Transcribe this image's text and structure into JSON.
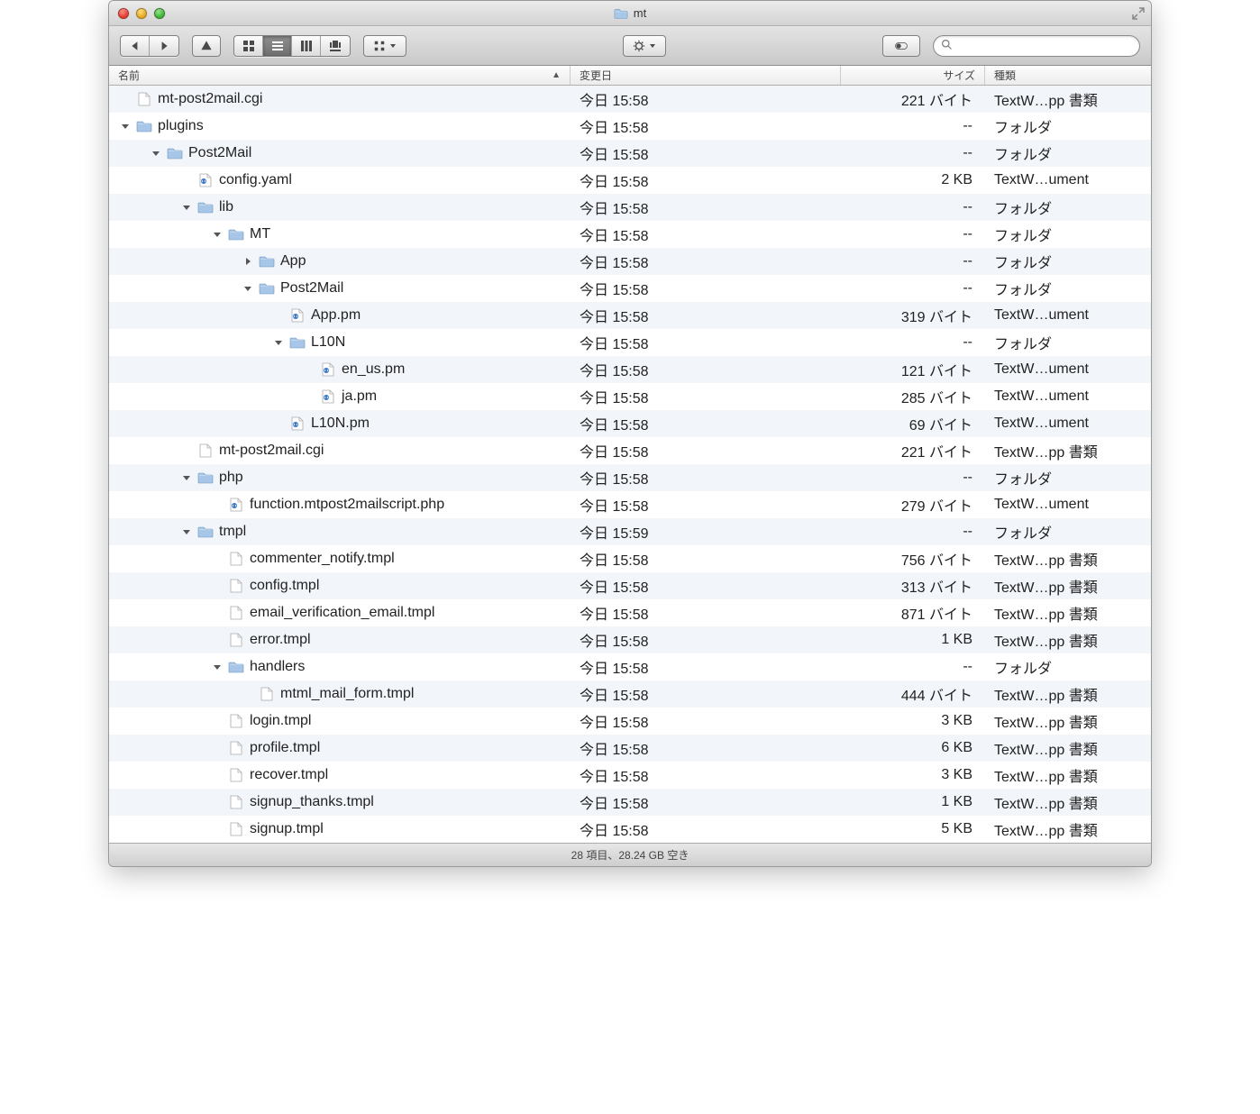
{
  "window": {
    "title": "mt"
  },
  "columns": {
    "name": "名前",
    "date": "変更日",
    "size": "サイズ",
    "kind": "種類"
  },
  "rows": [
    {
      "indent": 0,
      "disclosure": "none",
      "icon": "doc",
      "name": "mt-post2mail.cgi",
      "date": "今日 15:58",
      "size": "221 バイト",
      "kind": "TextW…pp 書類"
    },
    {
      "indent": 0,
      "disclosure": "open",
      "icon": "folder",
      "name": "plugins",
      "date": "今日 15:58",
      "size": "--",
      "kind": "フォルダ"
    },
    {
      "indent": 1,
      "disclosure": "open",
      "icon": "folder",
      "name": "Post2Mail",
      "date": "今日 15:58",
      "size": "--",
      "kind": "フォルダ"
    },
    {
      "indent": 2,
      "disclosure": "none",
      "icon": "code",
      "name": "config.yaml",
      "date": "今日 15:58",
      "size": "2 KB",
      "kind": "TextW…ument"
    },
    {
      "indent": 2,
      "disclosure": "open",
      "icon": "folder",
      "name": "lib",
      "date": "今日 15:58",
      "size": "--",
      "kind": "フォルダ"
    },
    {
      "indent": 3,
      "disclosure": "open",
      "icon": "folder",
      "name": "MT",
      "date": "今日 15:58",
      "size": "--",
      "kind": "フォルダ"
    },
    {
      "indent": 4,
      "disclosure": "closed",
      "icon": "folder",
      "name": "App",
      "date": "今日 15:58",
      "size": "--",
      "kind": "フォルダ"
    },
    {
      "indent": 4,
      "disclosure": "open",
      "icon": "folder",
      "name": "Post2Mail",
      "date": "今日 15:58",
      "size": "--",
      "kind": "フォルダ"
    },
    {
      "indent": 5,
      "disclosure": "none",
      "icon": "code",
      "name": "App.pm",
      "date": "今日 15:58",
      "size": "319 バイト",
      "kind": "TextW…ument"
    },
    {
      "indent": 5,
      "disclosure": "open",
      "icon": "folder",
      "name": "L10N",
      "date": "今日 15:58",
      "size": "--",
      "kind": "フォルダ"
    },
    {
      "indent": 6,
      "disclosure": "none",
      "icon": "code",
      "name": "en_us.pm",
      "date": "今日 15:58",
      "size": "121 バイト",
      "kind": "TextW…ument"
    },
    {
      "indent": 6,
      "disclosure": "none",
      "icon": "code",
      "name": "ja.pm",
      "date": "今日 15:58",
      "size": "285 バイト",
      "kind": "TextW…ument"
    },
    {
      "indent": 5,
      "disclosure": "none",
      "icon": "code",
      "name": "L10N.pm",
      "date": "今日 15:58",
      "size": "69 バイト",
      "kind": "TextW…ument"
    },
    {
      "indent": 2,
      "disclosure": "none",
      "icon": "doc",
      "name": "mt-post2mail.cgi",
      "date": "今日 15:58",
      "size": "221 バイト",
      "kind": "TextW…pp 書類"
    },
    {
      "indent": 2,
      "disclosure": "open",
      "icon": "folder",
      "name": "php",
      "date": "今日 15:58",
      "size": "--",
      "kind": "フォルダ"
    },
    {
      "indent": 3,
      "disclosure": "none",
      "icon": "code",
      "name": "function.mtpost2mailscript.php",
      "date": "今日 15:58",
      "size": "279 バイト",
      "kind": "TextW…ument"
    },
    {
      "indent": 2,
      "disclosure": "open",
      "icon": "folder",
      "name": "tmpl",
      "date": "今日 15:59",
      "size": "--",
      "kind": "フォルダ"
    },
    {
      "indent": 3,
      "disclosure": "none",
      "icon": "doc",
      "name": "commenter_notify.tmpl",
      "date": "今日 15:58",
      "size": "756 バイト",
      "kind": "TextW…pp 書類"
    },
    {
      "indent": 3,
      "disclosure": "none",
      "icon": "doc",
      "name": "config.tmpl",
      "date": "今日 15:58",
      "size": "313 バイト",
      "kind": "TextW…pp 書類"
    },
    {
      "indent": 3,
      "disclosure": "none",
      "icon": "doc",
      "name": "email_verification_email.tmpl",
      "date": "今日 15:58",
      "size": "871 バイト",
      "kind": "TextW…pp 書類"
    },
    {
      "indent": 3,
      "disclosure": "none",
      "icon": "doc",
      "name": "error.tmpl",
      "date": "今日 15:58",
      "size": "1 KB",
      "kind": "TextW…pp 書類"
    },
    {
      "indent": 3,
      "disclosure": "open",
      "icon": "folder",
      "name": "handlers",
      "date": "今日 15:58",
      "size": "--",
      "kind": "フォルダ"
    },
    {
      "indent": 4,
      "disclosure": "none",
      "icon": "doc",
      "name": "mtml_mail_form.tmpl",
      "date": "今日 15:58",
      "size": "444 バイト",
      "kind": "TextW…pp 書類"
    },
    {
      "indent": 3,
      "disclosure": "none",
      "icon": "doc",
      "name": "login.tmpl",
      "date": "今日 15:58",
      "size": "3 KB",
      "kind": "TextW…pp 書類"
    },
    {
      "indent": 3,
      "disclosure": "none",
      "icon": "doc",
      "name": "profile.tmpl",
      "date": "今日 15:58",
      "size": "6 KB",
      "kind": "TextW…pp 書類"
    },
    {
      "indent": 3,
      "disclosure": "none",
      "icon": "doc",
      "name": "recover.tmpl",
      "date": "今日 15:58",
      "size": "3 KB",
      "kind": "TextW…pp 書類"
    },
    {
      "indent": 3,
      "disclosure": "none",
      "icon": "doc",
      "name": "signup_thanks.tmpl",
      "date": "今日 15:58",
      "size": "1 KB",
      "kind": "TextW…pp 書類"
    },
    {
      "indent": 3,
      "disclosure": "none",
      "icon": "doc",
      "name": "signup.tmpl",
      "date": "今日 15:58",
      "size": "5 KB",
      "kind": "TextW…pp 書類"
    }
  ],
  "statusbar": "28 項目、28.24 GB 空き"
}
